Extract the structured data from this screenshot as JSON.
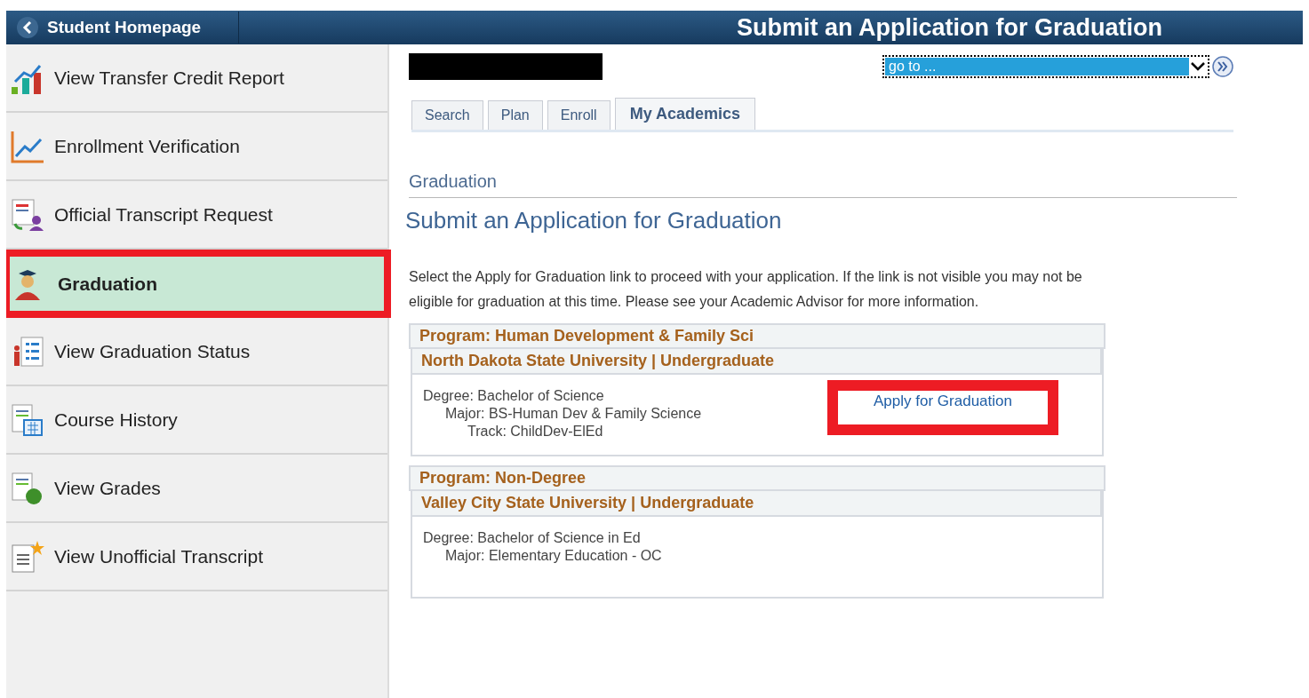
{
  "header": {
    "back_label": "Student Homepage",
    "title": "Submit an Application for Graduation"
  },
  "sidebar": {
    "items": [
      {
        "label": "View Transfer Credit Report",
        "selected": false,
        "highlighted": false
      },
      {
        "label": "Enrollment Verification",
        "selected": false,
        "highlighted": false
      },
      {
        "label": "Official Transcript Request",
        "selected": false,
        "highlighted": false
      },
      {
        "label": "Graduation",
        "selected": true,
        "highlighted": true
      },
      {
        "label": "View Graduation Status",
        "selected": false,
        "highlighted": false
      },
      {
        "label": "Course History",
        "selected": false,
        "highlighted": false
      },
      {
        "label": "View Grades",
        "selected": false,
        "highlighted": false
      },
      {
        "label": "View Unofficial Transcript",
        "selected": false,
        "highlighted": false
      }
    ]
  },
  "goto": {
    "value": "go to ..."
  },
  "tabs": [
    {
      "label": "Search",
      "selected": false
    },
    {
      "label": "Plan",
      "selected": false
    },
    {
      "label": "Enroll",
      "selected": false
    },
    {
      "label": "My Academics",
      "selected": true
    }
  ],
  "section": "Graduation",
  "page_title": "Submit an Application for Graduation",
  "instructions": "Select the Apply for Graduation link to proceed with your application. If the link is not visible you may not be eligible for graduation at this time. Please see your Academic Advisor for more information.",
  "programs": [
    {
      "program": "Program: Human Development & Family Sci",
      "institution": "North Dakota State University | Undergraduate",
      "lines": [
        "Degree: Bachelor of Science",
        "Major: BS-Human Dev & Family Science",
        "Track: ChildDev-ElEd"
      ],
      "link": {
        "label": "Apply for Graduation",
        "highlighted": true
      }
    },
    {
      "program": "Program: Non-Degree",
      "institution": "Valley City State University | Undergraduate",
      "lines": [
        "Degree: Bachelor of Science in Ed",
        "Major: Elementary Education - OC"
      ]
    }
  ]
}
